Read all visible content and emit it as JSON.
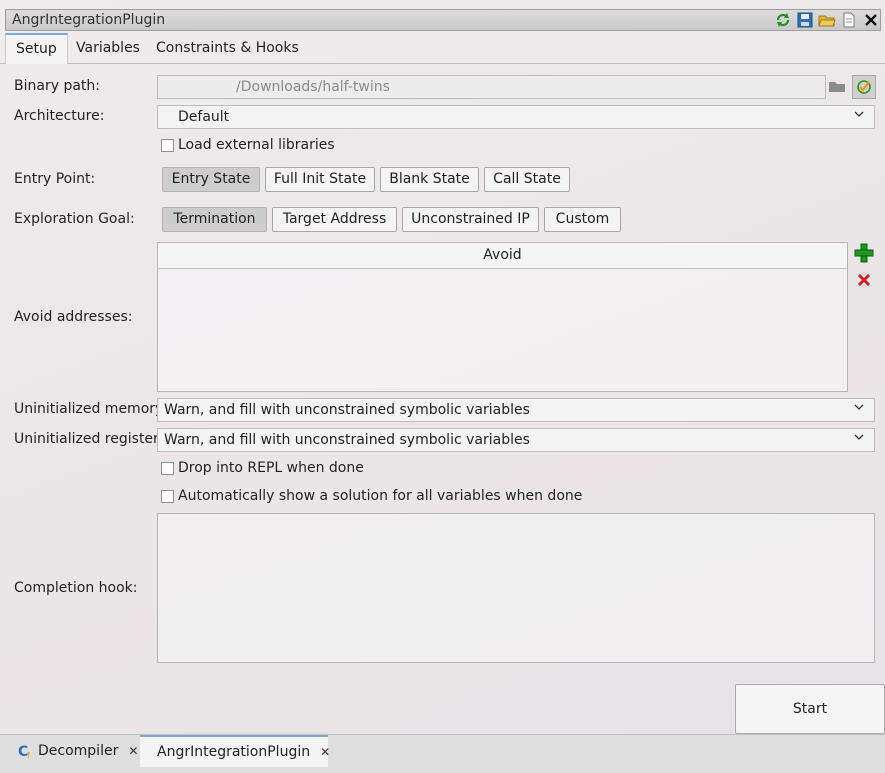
{
  "window": {
    "title": "AngrIntegrationPlugin"
  },
  "toolbar": {
    "icons": [
      "refresh-icon",
      "save-icon",
      "open-folder-icon",
      "new-file-icon",
      "close-icon"
    ]
  },
  "tabs": [
    {
      "label": "Setup"
    },
    {
      "label": "Variables"
    },
    {
      "label": "Constraints & Hooks"
    }
  ],
  "setup": {
    "binary_path_label": "Binary path:",
    "binary_path_value": "/Downloads/half-twins",
    "architecture_label": "Architecture:",
    "architecture_value": "Default",
    "load_ext_label": "Load external libraries",
    "entry_point_label": "Entry Point:",
    "entry_buttons": [
      "Entry State",
      "Full Init State",
      "Blank State",
      "Call State"
    ],
    "goal_label": "Exploration Goal:",
    "goal_buttons": [
      "Termination",
      "Target Address",
      "Unconstrained IP",
      "Custom"
    ],
    "avoid_label": "Avoid addresses:",
    "avoid_header": "Avoid",
    "uninit_mem_label": "Uninitialized memory:",
    "uninit_mem_value": "Warn, and fill with unconstrained symbolic variables",
    "uninit_reg_label": "Uninitialized registers:",
    "uninit_reg_value": "Warn, and fill with unconstrained symbolic variables",
    "repl_label": "Drop into REPL when done",
    "auto_solution_label": "Automatically show a solution for all variables when done",
    "completion_label": "Completion hook:",
    "start_label": "Start"
  },
  "bottom_tabs": [
    {
      "label": "Decompiler"
    },
    {
      "label": "AngrIntegrationPlugin"
    }
  ],
  "colors": {
    "accent": "#7aa7d8",
    "add_green": "#1d9a1d",
    "delete_red": "#cc2222"
  }
}
